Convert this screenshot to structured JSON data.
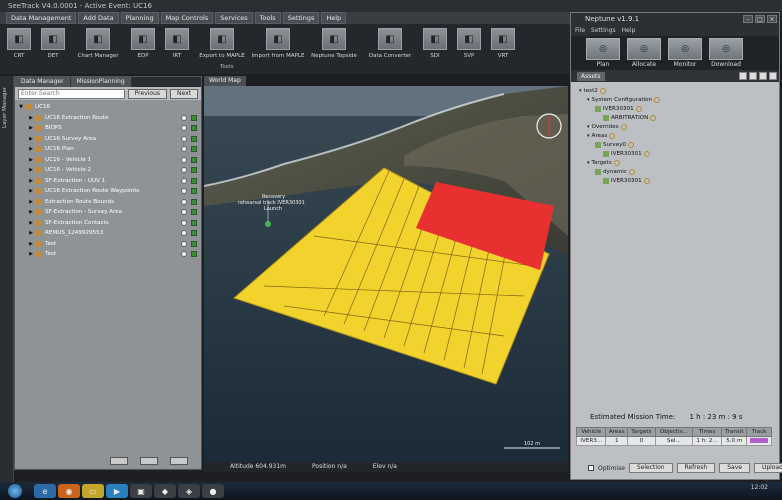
{
  "window": {
    "title": "SeeTrack V4.0.0001 - Active Event: UC16"
  },
  "menubar": [
    "Data Management",
    "Add Data",
    "Planning",
    "Map Controls",
    "Services",
    "Tools",
    "Settings",
    "Help"
  ],
  "toolbar": {
    "tools": [
      {
        "label": "CRT",
        "icon": "crt-icon"
      },
      {
        "label": "DET",
        "icon": "det-icon"
      },
      {
        "label": "Chart Manager",
        "icon": "chart-manager-icon"
      },
      {
        "label": "EDP",
        "icon": "edp-icon"
      },
      {
        "label": "IRT",
        "icon": "irt-icon"
      },
      {
        "label": "Export to MAPLE",
        "icon": "export-icon"
      },
      {
        "label": "Import from MAPLE",
        "icon": "import-icon"
      },
      {
        "label": "Neptune Topside",
        "icon": "neptune-icon"
      },
      {
        "label": "Data Converter",
        "icon": "converter-icon"
      },
      {
        "label": "SDI",
        "icon": "sdi-icon"
      },
      {
        "label": "SVP",
        "icon": "svp-icon"
      },
      {
        "label": "VRT",
        "icon": "vrt-icon"
      }
    ],
    "caption": "Tools"
  },
  "layer_strip": "Layer Manager",
  "data_manager": {
    "tabs": [
      "Data Manager",
      "MissionPlanning"
    ],
    "search_placeholder": "Enter Search",
    "prev_label": "Previous",
    "next_label": "Next",
    "tree": [
      {
        "label": "UC16",
        "level": 0
      },
      {
        "label": "UC16 Extraction Route",
        "level": 1
      },
      {
        "label": "BIOPS",
        "level": 1
      },
      {
        "label": "UC16 Survey Area",
        "level": 1
      },
      {
        "label": "UC16 Plan",
        "level": 1
      },
      {
        "label": "UC16 - Vehicle 1",
        "level": 1
      },
      {
        "label": "UC16 - Vehicle 2",
        "level": 1
      },
      {
        "label": "SF-Extraction - UUV 1",
        "level": 1
      },
      {
        "label": "UC16 Extraction Route Waypoints",
        "level": 1
      },
      {
        "label": "Extraction Route Bounds",
        "level": 1
      },
      {
        "label": "SF-Extraction - Survey Area",
        "level": 1
      },
      {
        "label": "SF-Extraction Contacts",
        "level": 1
      },
      {
        "label": "REMUS_1249929553",
        "level": 1
      },
      {
        "label": "Test",
        "level": 1
      },
      {
        "label": "Test",
        "level": 1
      }
    ]
  },
  "map": {
    "tab_label": "World Map",
    "labels": [
      "Recovery",
      "rehearsal track IVER30301",
      "Launch"
    ],
    "scale": "102 m",
    "altitude": "Altitude 604.931m",
    "position": "Position n/a",
    "elevation": "Elev n/a"
  },
  "neptune": {
    "title": "Neptune v1.9.1",
    "menu": [
      "File",
      "Settings",
      "Help"
    ],
    "tools": [
      {
        "label": "Plan",
        "icon": "plan-icon"
      },
      {
        "label": "Allocate",
        "icon": "allocate-icon"
      },
      {
        "label": "Monitor",
        "icon": "monitor-icon"
      },
      {
        "label": "Download",
        "icon": "download-icon"
      }
    ],
    "assets_tab": "Assets",
    "tree": [
      {
        "label": "test2",
        "level": 0
      },
      {
        "label": "System Configuration",
        "level": 1
      },
      {
        "label": "IVER30301",
        "level": 2
      },
      {
        "label": "ARBITRATION",
        "level": 3
      },
      {
        "label": "Overrides",
        "level": 1
      },
      {
        "label": "Areas",
        "level": 1
      },
      {
        "label": "Survey0",
        "level": 2
      },
      {
        "label": "IVER30301",
        "level": 3
      },
      {
        "label": "Targets",
        "level": 1
      },
      {
        "label": "dynamic",
        "level": 2
      },
      {
        "label": "IVER30301",
        "level": 3
      }
    ],
    "estimated_label": "Estimated Mission Time:",
    "estimated_value": "1 h : 23 m : 9 s",
    "table": {
      "headers": [
        "Vehicle",
        "Areas",
        "Targets",
        "Objectiv...",
        "Times",
        "Transit",
        "Track"
      ],
      "rows": [
        [
          "IVER3...",
          "1",
          "0",
          "Sel...",
          "1 h: 2...",
          "5.0 m",
          ""
        ]
      ]
    },
    "optimise_label": "Optimise",
    "selection_label": "Selection",
    "refresh_label": "Refresh",
    "save_label": "Save",
    "upload_label": "Upload"
  },
  "taskbar": {
    "time": "12:02",
    "date": ""
  },
  "colors": {
    "survey_area": "#f2d22c",
    "exclusion_zone": "#e83030",
    "track": "#b35fc8"
  }
}
